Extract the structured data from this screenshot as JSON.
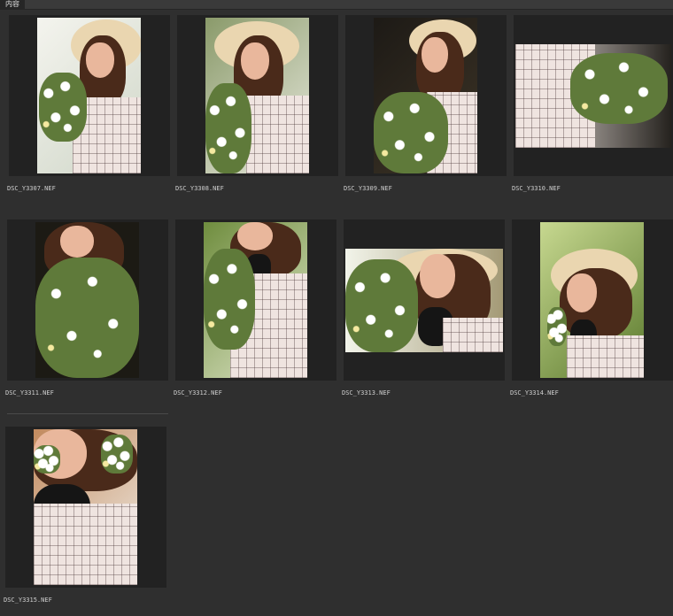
{
  "panel": {
    "tab_label": "内容"
  },
  "items": [
    {
      "filename": "DSC_Y3307.NEF"
    },
    {
      "filename": "DSC_Y3308.NEF"
    },
    {
      "filename": "DSC_Y3309.NEF"
    },
    {
      "filename": "DSC_Y3310.NEF"
    },
    {
      "filename": "DSC_Y3311.NEF"
    },
    {
      "filename": "DSC_Y3312.NEF"
    },
    {
      "filename": "DSC_Y3313.NEF"
    },
    {
      "filename": "DSC_Y3314.NEF"
    },
    {
      "filename": "DSC_Y3315.NEF"
    }
  ]
}
